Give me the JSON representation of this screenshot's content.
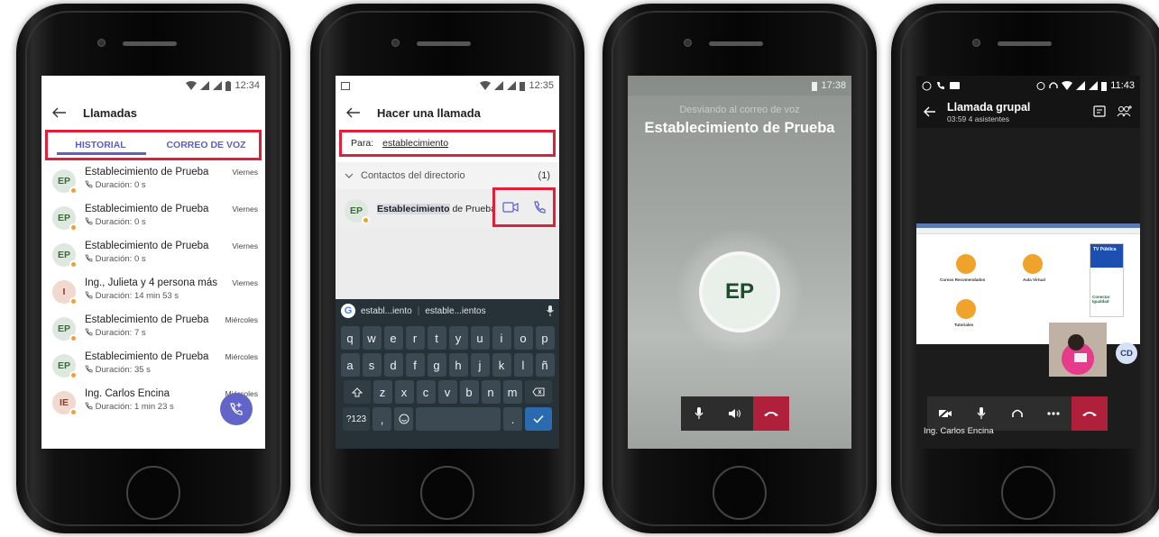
{
  "phone1": {
    "status_time": "12:34",
    "title": "Llamadas",
    "tabs": [
      "HISTORIAL",
      "CORREO DE VOZ"
    ],
    "calls": [
      {
        "initials": "EP",
        "name": "Establecimiento de Prueba",
        "duration": "Duración: 0 s",
        "day": "Viernes"
      },
      {
        "initials": "EP",
        "name": "Establecimiento de Prueba",
        "duration": "Duración: 0 s",
        "day": "Viernes"
      },
      {
        "initials": "EP",
        "name": "Establecimiento de Prueba",
        "duration": "Duración: 0 s",
        "day": "Viernes"
      },
      {
        "initials": "I",
        "name": "Ing., Julieta y 4 persona más",
        "duration": "Duración: 14 min 53 s",
        "day": "Viernes"
      },
      {
        "initials": "EP",
        "name": "Establecimiento de Prueba",
        "duration": "Duración: 7 s",
        "day": "Miércoles"
      },
      {
        "initials": "EP",
        "name": "Establecimiento de Prueba",
        "duration": "Duración: 35 s",
        "day": "Miércoles"
      },
      {
        "initials": "IE",
        "name": "Ing. Carlos Encina",
        "duration": "Duración: 1 min 23 s",
        "day": "Miércoles"
      }
    ],
    "accent": "#5b5fc7",
    "highlight": "#e0203a"
  },
  "phone2": {
    "status_time": "12:35",
    "title": "Hacer una llamada",
    "para_label": "Para:",
    "para_value": "establecimiento",
    "directory_label": "Contactos del directorio",
    "directory_count": "(1)",
    "contact_initials": "EP",
    "contact_bold": "Establecimiento",
    "contact_rest": " de Prueba",
    "suggestions": [
      "establ...iento",
      "estable...ientos"
    ],
    "keys_row1": [
      "q",
      "w",
      "e",
      "r",
      "t",
      "y",
      "u",
      "i",
      "o",
      "p"
    ],
    "keys_row1_num": [
      "1",
      "2",
      "3",
      "4",
      "5",
      "6",
      "7",
      "8",
      "9",
      "0"
    ],
    "keys_row2": [
      "a",
      "s",
      "d",
      "f",
      "g",
      "h",
      "j",
      "k",
      "l",
      "ñ"
    ],
    "keys_row3": [
      "z",
      "x",
      "c",
      "v",
      "b",
      "n",
      "m"
    ],
    "key_numbers": "?123",
    "key_comma": ",",
    "key_period": "."
  },
  "phone3": {
    "status_time": "17:38",
    "subtitle": "Desviando al correo de voz",
    "name": "Establecimiento de Prueba",
    "initials": "EP",
    "hangup_color": "#b0203a"
  },
  "phone4": {
    "status_time": "11:43",
    "title": "Llamada grupal",
    "subtitle": "03:59  4 asistentes",
    "participant_initials": "CD",
    "bottom_name": "Ing. Carlos Encina",
    "shared_texts": [
      "Cursos Recomendados",
      "Aula Virtual",
      "Tutoriales",
      "TV Pública",
      "Conectar Igualdad"
    ],
    "hangup_color": "#b0203a"
  }
}
